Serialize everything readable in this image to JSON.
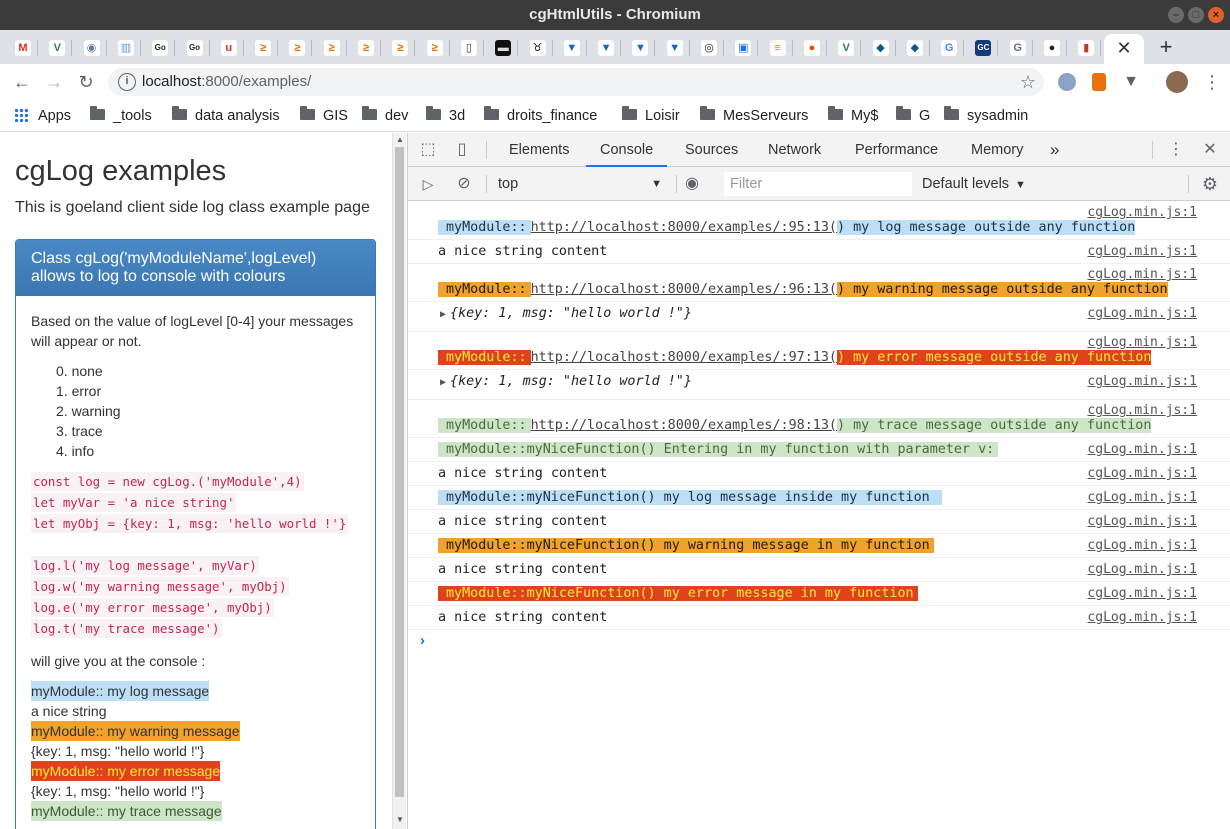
{
  "window": {
    "title": "cgHtmlUtils - Chromium"
  },
  "tabs": [
    {
      "icon": "gmail-icon",
      "glyph": "M",
      "color": "#ffffff",
      "fg": "#d93025"
    },
    {
      "icon": "vue-icon",
      "glyph": "V",
      "color": "#ffffff",
      "fg": "#2e7d4f"
    },
    {
      "icon": "owl-icon",
      "glyph": "◉",
      "color": "#ffffff",
      "fg": "#5f7a95"
    },
    {
      "icon": "book-icon",
      "glyph": "▥",
      "color": "#ffffff",
      "fg": "#5b9bd5"
    },
    {
      "icon": "godoc-icon",
      "glyph": "Go",
      "color": "#ffffff",
      "fg": "#222222"
    },
    {
      "icon": "godoc-icon",
      "glyph": "Go",
      "color": "#ffffff",
      "fg": "#222222"
    },
    {
      "icon": "u-icon",
      "glyph": "u",
      "color": "#ffffff",
      "fg": "#d93025"
    },
    {
      "icon": "arrow-icon",
      "glyph": "≥",
      "color": "#ffffff",
      "fg": "#e8710a"
    },
    {
      "icon": "arrow-icon",
      "glyph": "≥",
      "color": "#ffffff",
      "fg": "#e8710a"
    },
    {
      "icon": "arrow-icon",
      "glyph": "≥",
      "color": "#ffffff",
      "fg": "#e8710a"
    },
    {
      "icon": "arrow-icon",
      "glyph": "≥",
      "color": "#ffffff",
      "fg": "#e8710a"
    },
    {
      "icon": "arrow-icon",
      "glyph": "≥",
      "color": "#ffffff",
      "fg": "#e8710a"
    },
    {
      "icon": "arrow-icon",
      "glyph": "≥",
      "color": "#ffffff",
      "fg": "#e8710a"
    },
    {
      "icon": "open-book-icon",
      "glyph": "▯",
      "color": "#ffffff",
      "fg": "#333333"
    },
    {
      "icon": "terminal-icon",
      "glyph": "▬",
      "color": "#111111",
      "fg": "#dddddd"
    },
    {
      "icon": "bull-icon",
      "glyph": "♉",
      "color": "#ffffff",
      "fg": "#111111"
    },
    {
      "icon": "vuetify-icon",
      "glyph": "▼",
      "color": "#ffffff",
      "fg": "#1867c0"
    },
    {
      "icon": "vuetify-icon",
      "glyph": "▼",
      "color": "#ffffff",
      "fg": "#1867c0"
    },
    {
      "icon": "vuetify-icon",
      "glyph": "▼",
      "color": "#ffffff",
      "fg": "#1867c0"
    },
    {
      "icon": "vuetify-icon",
      "glyph": "▼",
      "color": "#ffffff",
      "fg": "#1867c0"
    },
    {
      "icon": "lifebuoy-icon",
      "glyph": "◎",
      "color": "#ffffff",
      "fg": "#222222"
    },
    {
      "icon": "frame-icon",
      "glyph": "▣",
      "color": "#ffffff",
      "fg": "#1a73e8"
    },
    {
      "icon": "stack-icon",
      "glyph": "≡",
      "color": "#ffffff",
      "fg": "#f48024"
    },
    {
      "icon": "reddit-icon",
      "glyph": "●",
      "color": "#ffffff",
      "fg": "#ff4500"
    },
    {
      "icon": "vue-icon",
      "glyph": "V",
      "color": "#ffffff",
      "fg": "#2e7d4f"
    },
    {
      "icon": "bird-icon",
      "glyph": "◆",
      "color": "#ffffff",
      "fg": "#0b5a8a"
    },
    {
      "icon": "bird-icon",
      "glyph": "◆",
      "color": "#ffffff",
      "fg": "#0b5a8a"
    },
    {
      "icon": "google-icon",
      "glyph": "G",
      "color": "#ffffff",
      "fg": "#4285f4"
    },
    {
      "icon": "gc-int-icon",
      "glyph": "GC",
      "color": "#123a7a",
      "fg": "#ffffff"
    },
    {
      "icon": "g-doc-icon",
      "glyph": "G",
      "color": "#ffffff",
      "fg": "#5b6f8c"
    },
    {
      "icon": "github-icon",
      "glyph": "●",
      "color": "#ffffff",
      "fg": "#222222"
    },
    {
      "icon": "box-icon",
      "glyph": "▮",
      "color": "#ffffff",
      "fg": "#c0392b"
    }
  ],
  "active_tab": {
    "close": "✕"
  },
  "new_tab": "+",
  "toolbar": {
    "url_host": "localhost",
    "url_rest": ":8000/examples/"
  },
  "bookmarks": [
    {
      "label": "Apps",
      "icon": "apps-icon"
    },
    {
      "label": "_tools",
      "icon": "folder-icon"
    },
    {
      "label": "data analysis",
      "icon": "folder-icon"
    },
    {
      "label": "GIS",
      "icon": "folder-icon"
    },
    {
      "label": "dev",
      "icon": "folder-icon"
    },
    {
      "label": "3d",
      "icon": "folder-icon"
    },
    {
      "label": "droits_finance",
      "icon": "folder-icon"
    },
    {
      "label": "Loisir",
      "icon": "folder-icon"
    },
    {
      "label": "MesServeurs",
      "icon": "folder-icon"
    },
    {
      "label": "My$",
      "icon": "folder-icon"
    },
    {
      "label": "G",
      "icon": "folder-icon"
    },
    {
      "label": "sysadmin",
      "icon": "folder-icon"
    }
  ],
  "page": {
    "title": "cgLog examples",
    "subtitle": "This is goeland client side log class example page",
    "panel_heading_1": "Class cgLog('myModuleName',logLevel)",
    "panel_heading_2": "allows to log to console with colours",
    "intro_1": "Based on the value of logLevel [0-4] your messages",
    "intro_2": "will appear or not.",
    "levels": [
      "0. none",
      "1. error",
      "2. warning",
      "3. trace",
      "4. info"
    ],
    "code_a": [
      "const log = new cgLog.('myModule',4)",
      "let myVar = 'a nice string'",
      "let myObj = {key: 1, msg: 'hello world !'}"
    ],
    "code_b": [
      "log.l('my log message', myVar)",
      "log.w('my warning message', myObj)",
      "log.e('my error message', myObj)",
      "log.t('my trace message')"
    ],
    "gives": "will give you at the console :",
    "outputs": [
      {
        "text": "myModule:: my log message",
        "kind": "o-log"
      },
      {
        "text": "a nice string",
        "kind": ""
      },
      {
        "text": "myModule:: my warning message",
        "kind": "o-warn"
      },
      {
        "text": "{key: 1, msg: \"hello world !\"}",
        "kind": ""
      },
      {
        "text": "myModule:: my error message",
        "kind": "o-err"
      },
      {
        "text": "{key: 1, msg: \"hello world !\"}",
        "kind": ""
      },
      {
        "text": "myModule:: my trace message",
        "kind": "o-trace"
      }
    ]
  },
  "devtools": {
    "tabs": [
      "Elements",
      "Console",
      "Sources",
      "Network",
      "Performance",
      "Memory"
    ],
    "active_tab": "Console",
    "more": "»",
    "context": "top",
    "filter_placeholder": "Filter",
    "levels": "Default levels",
    "messages": [
      {
        "type": "styled",
        "kind": "c-log",
        "prefix": "myModule::",
        "url": "http://localhost:8000/examples/:95:13(",
        "text": ") my log message outside any function",
        "src": "cgLog.min.js:1",
        "srcTop": true
      },
      {
        "type": "plain",
        "text": "a nice string content",
        "src": "cgLog.min.js:1"
      },
      {
        "type": "styled",
        "kind": "c-warn",
        "prefix": "myModule::",
        "url": "http://localhost:8000/examples/:96:13(",
        "text": ") my warning message outside any function",
        "src": "cgLog.min.js:1",
        "srcTop": true
      },
      {
        "type": "object",
        "text": "{key: 1, msg: \"hello world !\"}",
        "src": "cgLog.min.js:1"
      },
      {
        "type": "styled",
        "kind": "c-err",
        "prefix": "myModule::",
        "url": "http://localhost:8000/examples/:97:13(",
        "text": ") my error message outside any function",
        "src": "cgLog.min.js:1",
        "srcTop": true
      },
      {
        "type": "object",
        "text": "{key: 1, msg: \"hello world !\"}",
        "src": "cgLog.min.js:1"
      },
      {
        "type": "styled",
        "kind": "c-trace",
        "prefix": "myModule::",
        "url": "http://localhost:8000/examples/:98:13(",
        "text": ") my trace message outside any function",
        "src": "cgLog.min.js:1",
        "srcTop": true
      },
      {
        "type": "single",
        "kind": "c-trace",
        "text": "myModule::myNiceFunction() Entering in my function with parameter v:",
        "src": "cgLog.min.js:1"
      },
      {
        "type": "plain",
        "text": "a nice string content",
        "src": "cgLog.min.js:1"
      },
      {
        "type": "single",
        "kind": "c-log",
        "text": "myModule::myNiceFunction() my log message inside my function ",
        "src": "cgLog.min.js:1"
      },
      {
        "type": "plain",
        "text": "a nice string content",
        "src": "cgLog.min.js:1"
      },
      {
        "type": "single",
        "kind": "c-warn",
        "text": "myModule::myNiceFunction() my warning message in my function",
        "src": "cgLog.min.js:1"
      },
      {
        "type": "plain",
        "text": "a nice string content",
        "src": "cgLog.min.js:1"
      },
      {
        "type": "single",
        "kind": "c-err",
        "text": "myModule::myNiceFunction() my error message in my function",
        "src": "cgLog.min.js:1"
      },
      {
        "type": "plain",
        "text": "a nice string content",
        "src": "cgLog.min.js:1"
      }
    ],
    "prompt": "›"
  }
}
